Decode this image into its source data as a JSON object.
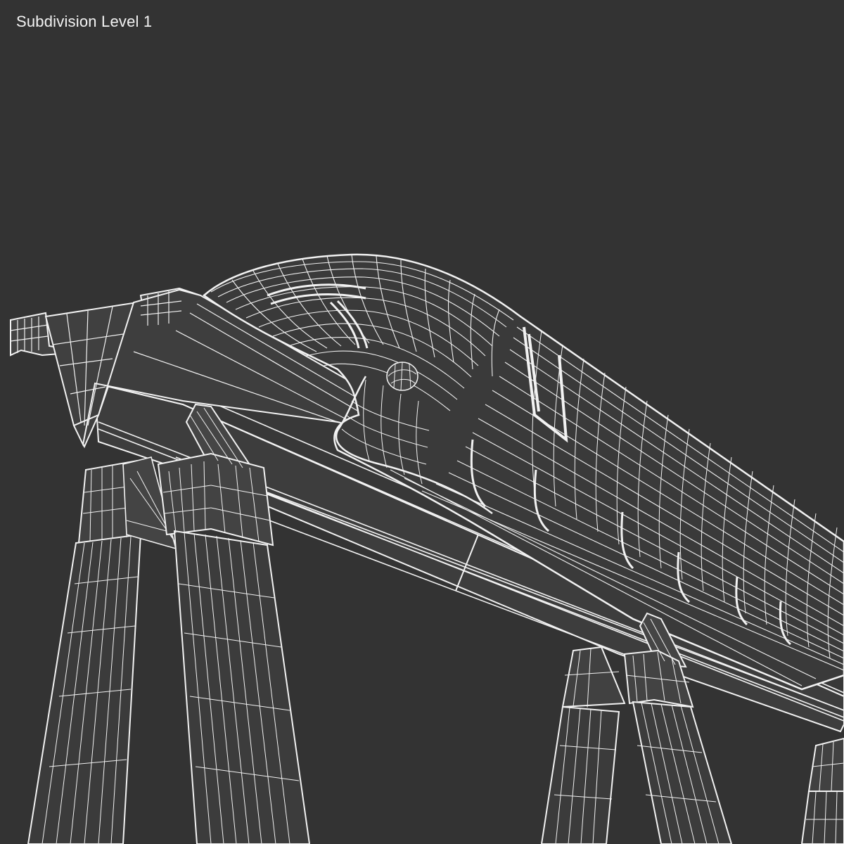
{
  "caption": "Subdivision Level 1",
  "colors": {
    "background": "#333333",
    "solid_face": "#3b3b3b",
    "solid_face_light": "#474747",
    "wire": "#f2f2f2"
  }
}
